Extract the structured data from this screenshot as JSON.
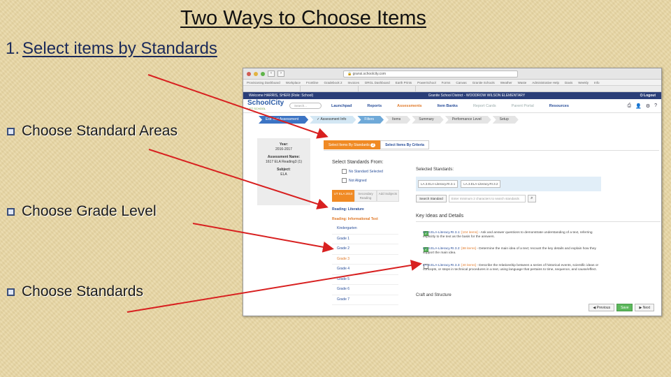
{
  "slide": {
    "title": "Two Ways to Choose Items",
    "subheading_number": "1.",
    "subheading_text": "Select items by Standards",
    "bullets": [
      "Choose Standard Areas",
      "Choose Grade Level",
      "Choose Standards"
    ]
  },
  "browser": {
    "url": "🔒 gransi.schoolcity.com",
    "bookmarks": [
      "Provisioning Dashboard",
      "Workplace",
      "Frontline",
      "Gradebook 2",
      "Invoices",
      "DRGL Dashboard",
      "Earth Prints",
      "PowerSchool",
      "Forms",
      "Canvas",
      "Granite Schools",
      "Weather",
      "Waste",
      "Administrative Help",
      "Davis",
      "Weekly",
      "Info"
    ]
  },
  "app": {
    "welcome": "Welcome HARRIS, SHERI (Role: School)",
    "district": "Granite School District - WOODROW WILSON ELEMENTARY",
    "logout": "⏻ Logout",
    "logo_main": "SchoolCity",
    "logo_sub": "LIFT SCHOOL",
    "search_placeholder": "Search...",
    "nav": [
      "Launchpad",
      "Reports",
      "Assessments",
      "Item Banks",
      "Report Cards",
      "Parent Portal",
      "Resources"
    ],
    "wizard": [
      "Exit Test Assessment",
      "✓ Assessment Info",
      "Filters",
      "Items",
      "Summary",
      "Performance Level",
      "Setup"
    ],
    "summary": {
      "year_label": "Year:",
      "year": "2016-2017",
      "name_label": "Assessment Name:",
      "name": "1617 ELA Reading3 (1)",
      "subject_label": "Subject:",
      "subject": "ELA"
    },
    "tabs": {
      "by_standards": "Select Items By Standards",
      "badge": "2",
      "by_criteria": "Select Items By Criteria"
    },
    "select_from": "Select Standards From:",
    "options": [
      "No Standard Selected",
      "Not Aligned"
    ],
    "left_tabs": [
      "UT ELA 2010",
      "Secondary Reading",
      "Add Subjects"
    ],
    "left_list": {
      "heading1": "Reading: Literature",
      "heading2": "Reading: Informational Text",
      "grades": [
        "Kindergarten",
        "Grade 1",
        "Grade 2",
        "Grade 3",
        "Grade 4",
        "Grade 5",
        "Grade 6",
        "Grade 7"
      ]
    },
    "selected_title": "Selected Standards:",
    "chips": [
      "LA.3.ELA-Literacy.RI.3.1",
      "LA.3.ELA-Literacy.RI.3.2"
    ],
    "search_btn": "Search Standard",
    "search_hint": "Enter minimum 2 characters to search standards",
    "key_ideas": "Key Ideas and Details",
    "standards": [
      {
        "code": "LA.3.ELA-Literacy.RI.3.1:",
        "count": "[104 items]",
        "text": " - Ask and answer questions to demonstrate understanding of a text, referring explicitly to the text as the basis for the answers."
      },
      {
        "code": "LA.3.ELA-Literacy.RI.3.2:",
        "count": "[88 items]",
        "text": " - Determine the main idea of a text; recount the key details and explain how they support the main idea."
      },
      {
        "code": "LA.3.ELA-Literacy.RI.3.3:",
        "count": "[40 items]",
        "text": " - Describe the relationship between a series of historical events, scientific ideas or concepts, or steps in technical procedures in a text, using language that pertains to time, sequence, and cause/effect."
      }
    ],
    "craft": "Craft and Structure",
    "buttons": {
      "previous": "◀ Previous",
      "save": "Save",
      "next": "▶ Next"
    }
  },
  "colors": {
    "accent": "#f08a24",
    "navy": "#2a3e78",
    "arrow": "#d82020"
  }
}
